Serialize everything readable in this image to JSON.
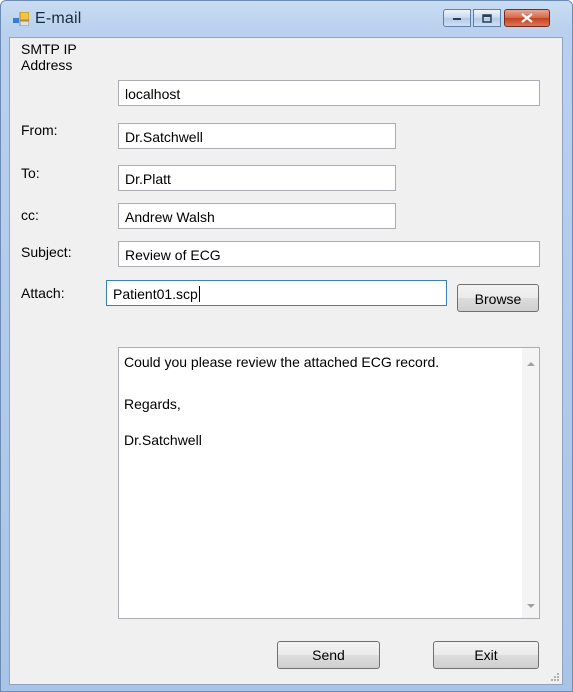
{
  "window": {
    "title": "E-mail",
    "accent": "#b9d1ee",
    "close_color": "#c4421f"
  },
  "form": {
    "smtp_label_line1": "SMTP IP",
    "smtp_label_line2": "Address",
    "smtp_value": "localhost",
    "from_label": "From:",
    "from_value": "Dr.Satchwell",
    "to_label": "To:",
    "to_value": "Dr.Platt",
    "cc_label": "cc:",
    "cc_value": "Andrew Walsh",
    "subject_label": "Subject:",
    "subject_value": "Review of ECG",
    "attach_label": "Attach:",
    "attach_value": "Patient01.scp",
    "browse_label": "Browse"
  },
  "message": {
    "line1": "Could you please review the attached ECG record.",
    "line2": "Regards,",
    "line3": "Dr.Satchwell"
  },
  "actions": {
    "send_label": "Send",
    "exit_label": "Exit"
  },
  "icons": {
    "app": "app-form-icon",
    "minimize": "minimize-icon",
    "maximize": "maximize-icon",
    "close": "close-icon"
  }
}
